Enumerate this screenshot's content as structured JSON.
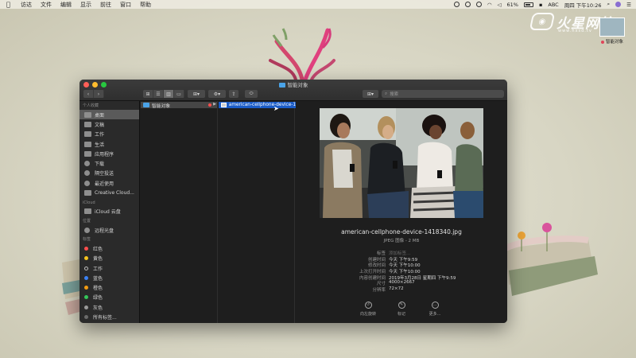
{
  "menubar": {
    "apple_icon": "apple-icon",
    "items": [
      "访达",
      "文件",
      "编辑",
      "显示",
      "前往",
      "窗口",
      "帮助"
    ],
    "battery": "61%",
    "input_source": "ABC",
    "datetime": "周四 下午10:26"
  },
  "watermark": {
    "logo_text": "火星网校",
    "sub_text": "www.hxsd.tv"
  },
  "desktop": {
    "item_label": "智能对象",
    "tag_color": "#e0455a"
  },
  "window": {
    "title": "智能对象",
    "search_placeholder": "搜索",
    "back": "‹",
    "forward": "›",
    "view_icons": [
      "⊞",
      "☰",
      "▥",
      "▭"
    ],
    "arrange": "⊞▾",
    "action": "⚙▾",
    "share": "⇪",
    "tags": "⬭",
    "group_toggle": "⊞▾"
  },
  "sidebar": {
    "sections": [
      {
        "title": "个人收藏",
        "items": [
          {
            "label": "桌面",
            "icon": "desktop-icon",
            "selected": true
          },
          {
            "label": "文稿",
            "icon": "documents-icon"
          },
          {
            "label": "工作",
            "icon": "folder-icon"
          },
          {
            "label": "生活",
            "icon": "folder-icon"
          },
          {
            "label": "应用程序",
            "icon": "applications-icon"
          },
          {
            "label": "下载",
            "icon": "downloads-icon"
          },
          {
            "label": "隔空投送",
            "icon": "airdrop-icon"
          },
          {
            "label": "最近使用",
            "icon": "recents-icon"
          },
          {
            "label": "Creative Cloud...",
            "icon": "creative-cloud-icon"
          }
        ]
      },
      {
        "title": "iCloud",
        "items": [
          {
            "label": "iCloud 云盘",
            "icon": "icloud-icon"
          }
        ]
      },
      {
        "title": "位置",
        "items": [
          {
            "label": "远程光盘",
            "icon": "disc-icon"
          }
        ]
      },
      {
        "title": "标签",
        "items": [
          {
            "label": "红色",
            "color": "#ff4d4d"
          },
          {
            "label": "黄色",
            "color": "#f5c31d"
          },
          {
            "label": "工作",
            "color": "#2a2a2a",
            "ring": true
          },
          {
            "label": "蓝色",
            "color": "#3b82f6"
          },
          {
            "label": "橙色",
            "color": "#f39c12"
          },
          {
            "label": "绿色",
            "color": "#34c759"
          },
          {
            "label": "灰色",
            "color": "#9a9a9a"
          },
          {
            "label": "所有标签...",
            "color": "#6a6a6a"
          }
        ]
      }
    ]
  },
  "columns": {
    "col1_item": "智能对象",
    "col2_item": "american-cellphone-device-1418340.jpg"
  },
  "preview": {
    "filename": "american-cellphone-device-1418340.jpg",
    "kind": "JPEG 图像 - 2 MB",
    "meta": [
      {
        "key": "标签",
        "value": "添加标签...",
        "placeholder": true
      },
      {
        "key": "创建时间",
        "value": "今天 下午9:59"
      },
      {
        "key": "修改时间",
        "value": "今天 下午10:00"
      },
      {
        "key": "上次打开时间",
        "value": "今天 下午10:00"
      },
      {
        "key": "内容创建时间",
        "value": "2019年3月28日 星期四 下午9:59"
      },
      {
        "key": "尺寸",
        "value": "4000×2667"
      },
      {
        "key": "分辨率",
        "value": "72×72"
      }
    ],
    "actions": [
      {
        "label": "向左旋转",
        "icon": "rotate-left-icon",
        "glyph": "↺"
      },
      {
        "label": "标记",
        "icon": "markup-icon",
        "glyph": "✎"
      },
      {
        "label": "更多...",
        "icon": "more-icon",
        "glyph": "…"
      }
    ]
  }
}
